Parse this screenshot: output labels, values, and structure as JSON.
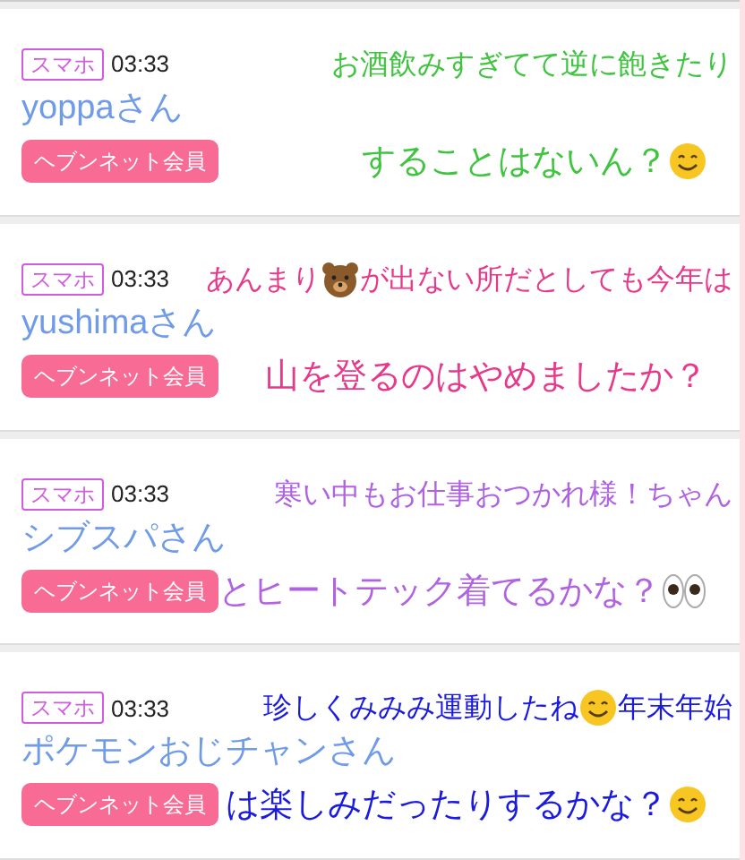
{
  "comments": [
    {
      "badge": "スマホ",
      "time": "03:33",
      "name": "yoppaさん",
      "member_button": "ヘブンネット会員",
      "color": "#3fc43f",
      "message": [
        [
          {
            "kind": "text",
            "text": "お酒飲みすぎてて逆に飽きたり"
          }
        ],
        [
          {
            "kind": "text",
            "text": "することはないん？"
          },
          {
            "kind": "smile"
          }
        ]
      ]
    },
    {
      "badge": "スマホ",
      "time": "03:33",
      "name": "yushimaさん",
      "member_button": "ヘブンネット会員",
      "color": "#e8388a",
      "message": [
        [
          {
            "kind": "text",
            "text": "あんまり"
          },
          {
            "kind": "bear"
          },
          {
            "kind": "text",
            "text": "が出ない所だとしても今年は"
          }
        ],
        [
          {
            "kind": "text",
            "text": "山を登るのはやめましたか？"
          }
        ]
      ]
    },
    {
      "badge": "スマホ",
      "time": "03:33",
      "name": "シブスパさん",
      "member_button": "ヘブンネット会員",
      "color": "#b062e0",
      "message": [
        [
          {
            "kind": "text",
            "text": "寒い中もお仕事おつかれ様！ちゃん"
          }
        ],
        [
          {
            "kind": "text",
            "text": "とヒートテック着てるかな？"
          },
          {
            "kind": "eyes"
          }
        ]
      ]
    },
    {
      "badge": "スマホ",
      "time": "03:33",
      "name": "ポケモンおじチャンさん",
      "member_button": "ヘブンネット会員",
      "color": "#1a1ae0",
      "message": [
        [
          {
            "kind": "text",
            "text": "珍しくみみみ運動したね"
          },
          {
            "kind": "smile"
          },
          {
            "kind": "text",
            "text": "年末年始"
          }
        ],
        [
          {
            "kind": "text",
            "text": "は楽しみだったりするかな？"
          },
          {
            "kind": "smile"
          }
        ]
      ]
    }
  ]
}
